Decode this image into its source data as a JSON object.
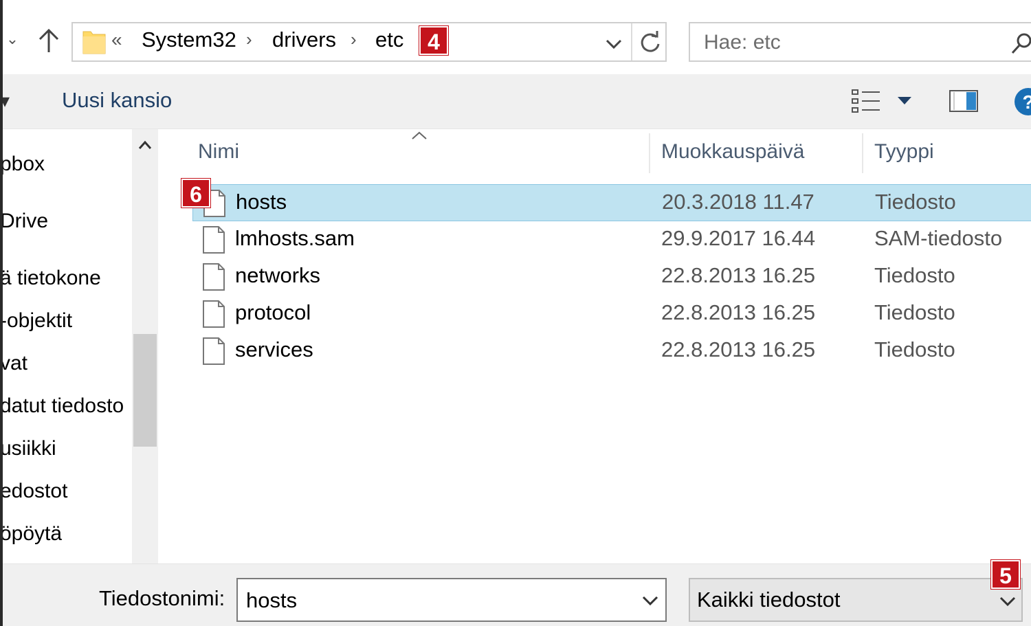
{
  "address_bar": {
    "overflow_glyph": "«",
    "breadcrumbs": [
      "System32",
      "drivers",
      "etc"
    ],
    "separator": "›",
    "badge": "4"
  },
  "search": {
    "placeholder": "Hae: etc"
  },
  "command_bar": {
    "new_folder_label": "Uusi kansio",
    "help_glyph": "?"
  },
  "nav_pane": {
    "items": [
      "pbox",
      "Drive",
      "ä tietokone",
      "-objektit",
      "vat",
      "datut tiedosto",
      "usiikki",
      "edostot",
      "öpöytä"
    ]
  },
  "file_list": {
    "columns": {
      "name": "Nimi",
      "modified": "Muokkauspäivä",
      "type": "Tyyppi"
    },
    "selected_badge": "6",
    "rows": [
      {
        "name": "hosts",
        "date": "20.3.2018 11.47",
        "type": "Tiedosto",
        "selected": true
      },
      {
        "name": "lmhosts.sam",
        "date": "29.9.2017 16.44",
        "type": "SAM-tiedosto",
        "selected": false
      },
      {
        "name": "networks",
        "date": "22.8.2013 16.25",
        "type": "Tiedosto",
        "selected": false
      },
      {
        "name": "protocol",
        "date": "22.8.2013 16.25",
        "type": "Tiedosto",
        "selected": false
      },
      {
        "name": "services",
        "date": "22.8.2013 16.25",
        "type": "Tiedosto",
        "selected": false
      }
    ]
  },
  "bottom_bar": {
    "filename_label": "Tiedostonimi:",
    "filename_value": "hosts",
    "filetype_value": "Kaikki tiedostot",
    "badge": "5"
  },
  "colors": {
    "selection": "#bfe3f1",
    "badge": "#c4141c",
    "help": "#1a6fb5"
  }
}
